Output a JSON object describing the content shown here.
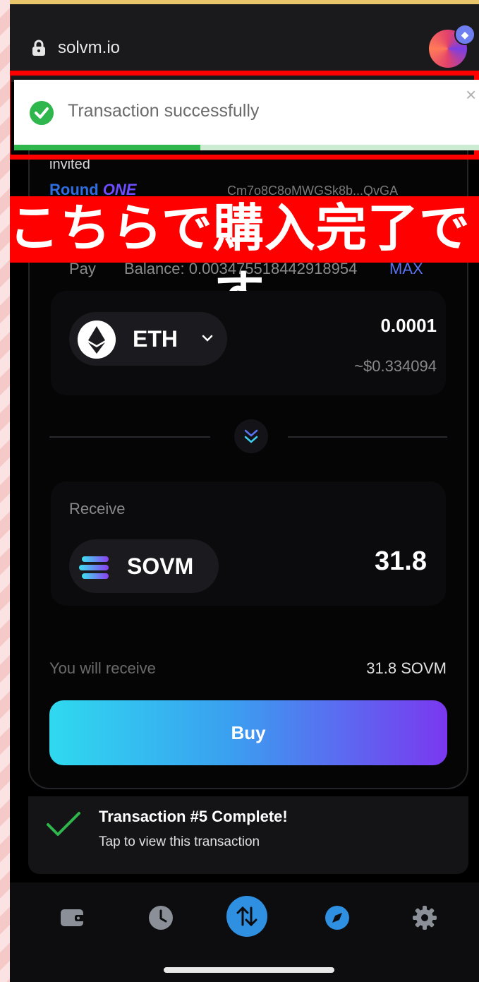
{
  "browser": {
    "url": "solvm.io",
    "avatar_badge": "◆"
  },
  "toast": {
    "message": "Transaction successfully",
    "close_symbol": "×",
    "progress": 0.4
  },
  "header": {
    "invited": "invited",
    "round_prefix": "Round",
    "round_name": "ONE",
    "address": "Cm7o8C8oMWGSk8b...QvGA"
  },
  "banner": {
    "text": "こちらで購入完了です"
  },
  "pay": {
    "label": "Pay",
    "balance": "Balance: 0.003475518442918954",
    "max_label": "MAX",
    "token": "ETH",
    "amount": "0.0001",
    "usd_value": "~$0.334094"
  },
  "receive": {
    "label": "Receive",
    "token": "SOVM",
    "amount": "31.8"
  },
  "summary": {
    "label": "You will receive",
    "value": "31.8 SOVM"
  },
  "buy_label": "Buy",
  "tx_notification": {
    "title": "Transaction #5 Complete!",
    "subtitle": "Tap to view this transaction"
  },
  "nav": [
    "wallet-icon",
    "history-clock-icon",
    "swap-icon",
    "explore-compass-icon",
    "settings-gear-icon"
  ],
  "colors": {
    "accent_blue": "#2f8fe0",
    "success_green": "#2fb64c",
    "banner_red": "#ff0000"
  }
}
